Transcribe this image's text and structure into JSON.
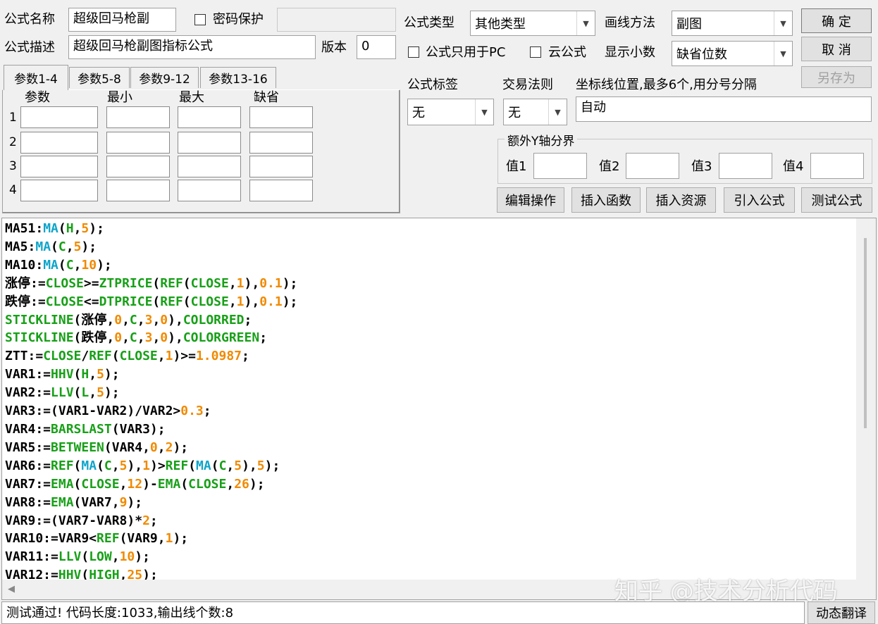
{
  "header": {
    "formula_name_label": "公式名称",
    "formula_name_value": "超级回马枪副",
    "password_label": "密码保护",
    "password_value": "",
    "formula_desc_label": "公式描述",
    "formula_desc_value": "超级回马枪副图指标公式",
    "version_label": "版本",
    "version_value": "0"
  },
  "options": {
    "type_label": "公式类型",
    "type_value": "其他类型",
    "draw_label": "画线方法",
    "draw_value": "副图",
    "pc_only_label": "公式只用于PC",
    "cloud_label": "云公式",
    "decimals_label": "显示小数",
    "decimals_value": "缺省位数",
    "tag_label": "公式标签",
    "tag_value": "无",
    "trade_label": "交易法则",
    "trade_value": "无",
    "axis_label": "坐标线位置,最多6个,用分号分隔",
    "axis_value": "自动",
    "yaxis_group_label": "额外Y轴分界",
    "y_labels": [
      "值1",
      "值2",
      "值3",
      "值4"
    ]
  },
  "buttons": {
    "ok": "确  定",
    "cancel": "取  消",
    "save_as": "另存为",
    "edit_ops": "编辑操作",
    "insert_func": "插入函数",
    "insert_res": "插入资源",
    "import_formula": "引入公式",
    "test_formula": "测试公式",
    "translate": "动态翻译"
  },
  "tabs": [
    "参数1-4",
    "参数5-8",
    "参数9-12",
    "参数13-16"
  ],
  "param_table": {
    "headers": [
      "参数",
      "最小",
      "最大",
      "缺省"
    ],
    "rows": [
      "1",
      "2",
      "3",
      "4"
    ]
  },
  "code_lines": [
    [
      [
        "k",
        "MA51:"
      ],
      [
        "f",
        "MA"
      ],
      [
        "k",
        "("
      ],
      [
        "g",
        "H"
      ],
      [
        "k",
        ","
      ],
      [
        "n",
        "5"
      ],
      [
        "k",
        ");"
      ]
    ],
    [
      [
        "k",
        "MA5:"
      ],
      [
        "f",
        "MA"
      ],
      [
        "k",
        "("
      ],
      [
        "g",
        "C"
      ],
      [
        "k",
        ","
      ],
      [
        "n",
        "5"
      ],
      [
        "k",
        ");"
      ]
    ],
    [
      [
        "k",
        "MA10:"
      ],
      [
        "f",
        "MA"
      ],
      [
        "k",
        "("
      ],
      [
        "g",
        "C"
      ],
      [
        "k",
        ","
      ],
      [
        "n",
        "10"
      ],
      [
        "k",
        ");"
      ]
    ],
    [
      [
        "k",
        "涨停:="
      ],
      [
        "g",
        "CLOSE"
      ],
      [
        "k",
        ">="
      ],
      [
        "g",
        "ZTPRICE"
      ],
      [
        "k",
        "("
      ],
      [
        "g",
        "REF"
      ],
      [
        "k",
        "("
      ],
      [
        "g",
        "CLOSE"
      ],
      [
        "k",
        ","
      ],
      [
        "n",
        "1"
      ],
      [
        "k",
        "),"
      ],
      [
        "n",
        "0.1"
      ],
      [
        "k",
        ");"
      ]
    ],
    [
      [
        "k",
        "跌停:="
      ],
      [
        "g",
        "CLOSE"
      ],
      [
        "k",
        "<="
      ],
      [
        "g",
        "DTPRICE"
      ],
      [
        "k",
        "("
      ],
      [
        "g",
        "REF"
      ],
      [
        "k",
        "("
      ],
      [
        "g",
        "CLOSE"
      ],
      [
        "k",
        ","
      ],
      [
        "n",
        "1"
      ],
      [
        "k",
        "),"
      ],
      [
        "n",
        "0.1"
      ],
      [
        "k",
        ");"
      ]
    ],
    [
      [
        "g",
        "STICKLINE"
      ],
      [
        "k",
        "(涨停,"
      ],
      [
        "n",
        "0"
      ],
      [
        "k",
        ","
      ],
      [
        "g",
        "C"
      ],
      [
        "k",
        ","
      ],
      [
        "n",
        "3"
      ],
      [
        "k",
        ","
      ],
      [
        "n",
        "0"
      ],
      [
        "k",
        "),"
      ],
      [
        "g",
        "COLORRED"
      ],
      [
        "k",
        ";"
      ]
    ],
    [
      [
        "g",
        "STICKLINE"
      ],
      [
        "k",
        "(跌停,"
      ],
      [
        "n",
        "0"
      ],
      [
        "k",
        ","
      ],
      [
        "g",
        "C"
      ],
      [
        "k",
        ","
      ],
      [
        "n",
        "3"
      ],
      [
        "k",
        ","
      ],
      [
        "n",
        "0"
      ],
      [
        "k",
        "),"
      ],
      [
        "g",
        "COLORGREEN"
      ],
      [
        "k",
        ";"
      ]
    ],
    [
      [
        "k",
        "ZTT:="
      ],
      [
        "g",
        "CLOSE"
      ],
      [
        "k",
        "/"
      ],
      [
        "g",
        "REF"
      ],
      [
        "k",
        "("
      ],
      [
        "g",
        "CLOSE"
      ],
      [
        "k",
        ","
      ],
      [
        "n",
        "1"
      ],
      [
        "k",
        ")>="
      ],
      [
        "n",
        "1.0987"
      ],
      [
        "k",
        ";"
      ]
    ],
    [
      [
        "k",
        "VAR1:="
      ],
      [
        "g",
        "HHV"
      ],
      [
        "k",
        "("
      ],
      [
        "g",
        "H"
      ],
      [
        "k",
        ","
      ],
      [
        "n",
        "5"
      ],
      [
        "k",
        ");"
      ]
    ],
    [
      [
        "k",
        "VAR2:="
      ],
      [
        "g",
        "LLV"
      ],
      [
        "k",
        "("
      ],
      [
        "g",
        "L"
      ],
      [
        "k",
        ","
      ],
      [
        "n",
        "5"
      ],
      [
        "k",
        ");"
      ]
    ],
    [
      [
        "k",
        "VAR3:=(VAR1-VAR2)/VAR2>"
      ],
      [
        "n",
        "0.3"
      ],
      [
        "k",
        ";"
      ]
    ],
    [
      [
        "k",
        "VAR4:="
      ],
      [
        "g",
        "BARSLAST"
      ],
      [
        "k",
        "(VAR3);"
      ]
    ],
    [
      [
        "k",
        "VAR5:="
      ],
      [
        "g",
        "BETWEEN"
      ],
      [
        "k",
        "(VAR4,"
      ],
      [
        "n",
        "0"
      ],
      [
        "k",
        ","
      ],
      [
        "n",
        "2"
      ],
      [
        "k",
        ");"
      ]
    ],
    [
      [
        "k",
        "VAR6:="
      ],
      [
        "g",
        "REF"
      ],
      [
        "k",
        "("
      ],
      [
        "f",
        "MA"
      ],
      [
        "k",
        "("
      ],
      [
        "g",
        "C"
      ],
      [
        "k",
        ","
      ],
      [
        "n",
        "5"
      ],
      [
        "k",
        "),"
      ],
      [
        "n",
        "1"
      ],
      [
        "k",
        ")>"
      ],
      [
        "g",
        "REF"
      ],
      [
        "k",
        "("
      ],
      [
        "f",
        "MA"
      ],
      [
        "k",
        "("
      ],
      [
        "g",
        "C"
      ],
      [
        "k",
        ","
      ],
      [
        "n",
        "5"
      ],
      [
        "k",
        "),"
      ],
      [
        "n",
        "5"
      ],
      [
        "k",
        ");"
      ]
    ],
    [
      [
        "k",
        "VAR7:="
      ],
      [
        "g",
        "EMA"
      ],
      [
        "k",
        "("
      ],
      [
        "g",
        "CLOSE"
      ],
      [
        "k",
        ","
      ],
      [
        "n",
        "12"
      ],
      [
        "k",
        ")-"
      ],
      [
        "g",
        "EMA"
      ],
      [
        "k",
        "("
      ],
      [
        "g",
        "CLOSE"
      ],
      [
        "k",
        ","
      ],
      [
        "n",
        "26"
      ],
      [
        "k",
        ");"
      ]
    ],
    [
      [
        "k",
        "VAR8:="
      ],
      [
        "g",
        "EMA"
      ],
      [
        "k",
        "(VAR7,"
      ],
      [
        "n",
        "9"
      ],
      [
        "k",
        ");"
      ]
    ],
    [
      [
        "k",
        "VAR9:=(VAR7-VAR8)*"
      ],
      [
        "n",
        "2"
      ],
      [
        "k",
        ";"
      ]
    ],
    [
      [
        "k",
        "VAR10:=VAR9<"
      ],
      [
        "g",
        "REF"
      ],
      [
        "k",
        "(VAR9,"
      ],
      [
        "n",
        "1"
      ],
      [
        "k",
        ");"
      ]
    ],
    [
      [
        "k",
        "VAR11:="
      ],
      [
        "g",
        "LLV"
      ],
      [
        "k",
        "("
      ],
      [
        "g",
        "LOW"
      ],
      [
        "k",
        ","
      ],
      [
        "n",
        "10"
      ],
      [
        "k",
        ");"
      ]
    ],
    [
      [
        "k",
        "VAR12:="
      ],
      [
        "g",
        "HHV"
      ],
      [
        "k",
        "("
      ],
      [
        "g",
        "HIGH"
      ],
      [
        "k",
        ","
      ],
      [
        "n",
        "25"
      ],
      [
        "k",
        ");"
      ]
    ]
  ],
  "status_text": "测试通过! 代码长度:1033,输出线个数:8",
  "watermark": "知乎 @技术分析代码",
  "colors": {
    "function_blue": "#0fa4c9",
    "keyword_green": "#18a018",
    "number_orange": "#f08a00"
  }
}
